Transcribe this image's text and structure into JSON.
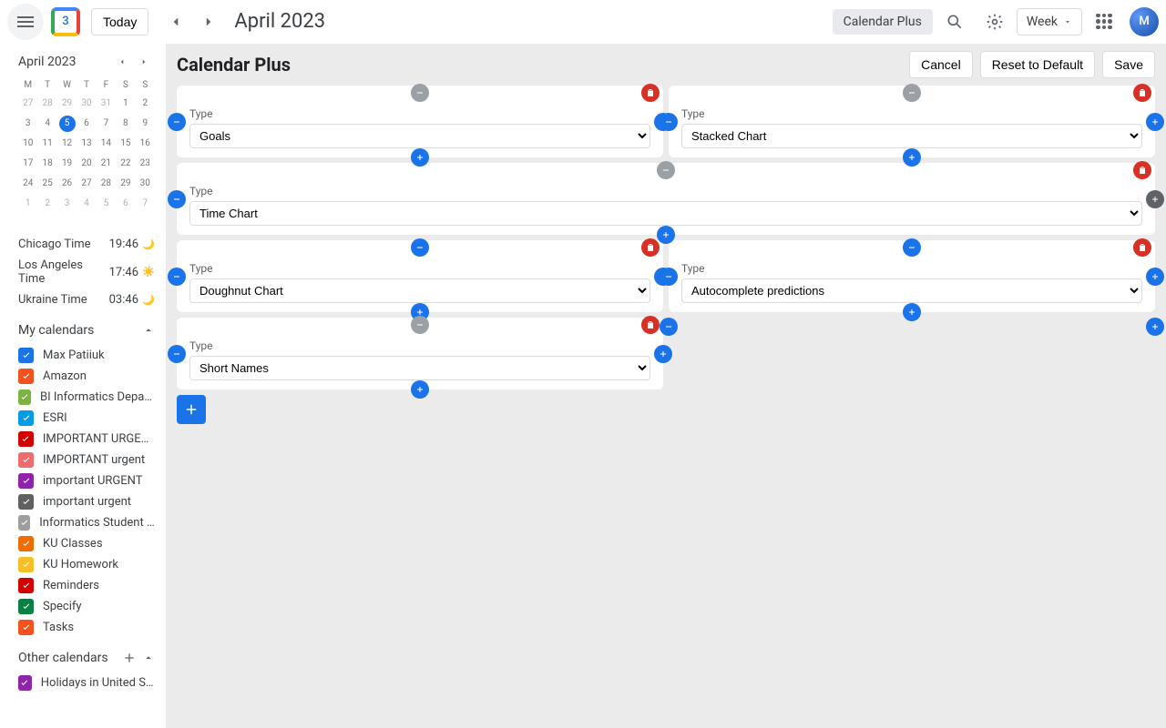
{
  "header": {
    "today": "Today",
    "month": "April 2023",
    "pill": "Calendar Plus",
    "view": "Week",
    "logo_day": "3",
    "avatar_initials": "M"
  },
  "mini": {
    "title": "April 2023",
    "dow": [
      "M",
      "T",
      "W",
      "T",
      "F",
      "S",
      "S"
    ],
    "weeks": [
      [
        {
          "n": "27",
          "m": true
        },
        {
          "n": "28",
          "m": true
        },
        {
          "n": "29",
          "m": true
        },
        {
          "n": "30",
          "m": true
        },
        {
          "n": "31",
          "m": true
        },
        {
          "n": "1"
        },
        {
          "n": "2"
        }
      ],
      [
        {
          "n": "3"
        },
        {
          "n": "4"
        },
        {
          "n": "5",
          "t": true
        },
        {
          "n": "6"
        },
        {
          "n": "7"
        },
        {
          "n": "8"
        },
        {
          "n": "9"
        }
      ],
      [
        {
          "n": "10"
        },
        {
          "n": "11"
        },
        {
          "n": "12"
        },
        {
          "n": "13"
        },
        {
          "n": "14"
        },
        {
          "n": "15"
        },
        {
          "n": "16"
        }
      ],
      [
        {
          "n": "17"
        },
        {
          "n": "18"
        },
        {
          "n": "19"
        },
        {
          "n": "20"
        },
        {
          "n": "21"
        },
        {
          "n": "22"
        },
        {
          "n": "23"
        }
      ],
      [
        {
          "n": "24"
        },
        {
          "n": "25"
        },
        {
          "n": "26"
        },
        {
          "n": "27"
        },
        {
          "n": "28"
        },
        {
          "n": "29"
        },
        {
          "n": "30"
        }
      ],
      [
        {
          "n": "1",
          "m": true
        },
        {
          "n": "2",
          "m": true
        },
        {
          "n": "3",
          "m": true
        },
        {
          "n": "4",
          "m": true
        },
        {
          "n": "5",
          "m": true
        },
        {
          "n": "6",
          "m": true
        },
        {
          "n": "7",
          "m": true
        }
      ]
    ]
  },
  "clocks": [
    {
      "name": "Chicago Time",
      "time": "19:46",
      "icon": "moon"
    },
    {
      "name": "Los Angeles Time",
      "time": "17:46",
      "icon": "sun"
    },
    {
      "name": "Ukraine Time",
      "time": "03:46",
      "icon": "moon"
    }
  ],
  "myCalTitle": "My calendars",
  "otherCalTitle": "Other calendars",
  "myCalendars": [
    {
      "label": "Max Patiiuk",
      "color": "#1a73e8"
    },
    {
      "label": "Amazon",
      "color": "#f4511e"
    },
    {
      "label": "BI Informatics Department",
      "color": "#7cb342"
    },
    {
      "label": "ESRI",
      "color": "#039be5"
    },
    {
      "label": "IMPORTANT URGENT",
      "color": "#d50000"
    },
    {
      "label": "IMPORTANT urgent",
      "color": "#ef6c6c"
    },
    {
      "label": "important URGENT",
      "color": "#8e24aa"
    },
    {
      "label": "important urgent",
      "color": "#616161"
    },
    {
      "label": "Informatics Student Sched…",
      "color": "#9e9e9e"
    },
    {
      "label": "KU Classes",
      "color": "#ef6c00"
    },
    {
      "label": "KU Homework",
      "color": "#f6bf26"
    },
    {
      "label": "Reminders",
      "color": "#d50000"
    },
    {
      "label": "Specify",
      "color": "#0b8043"
    },
    {
      "label": "Tasks",
      "color": "#f4511e"
    }
  ],
  "otherCalendars": [
    {
      "label": "Holidays in United States",
      "color": "#8e24aa"
    }
  ],
  "main": {
    "title": "Calendar Plus",
    "cancel": "Cancel",
    "reset": "Reset to Default",
    "save": "Save",
    "typeLabel": "Type",
    "cards": {
      "r1c1": "Goals",
      "r1c2": "Stacked Chart",
      "r2c1": "Time Chart",
      "r3c1": "Doughnut Chart",
      "r3c2": "Autocomplete predictions",
      "r4c1": "Short Names"
    }
  }
}
